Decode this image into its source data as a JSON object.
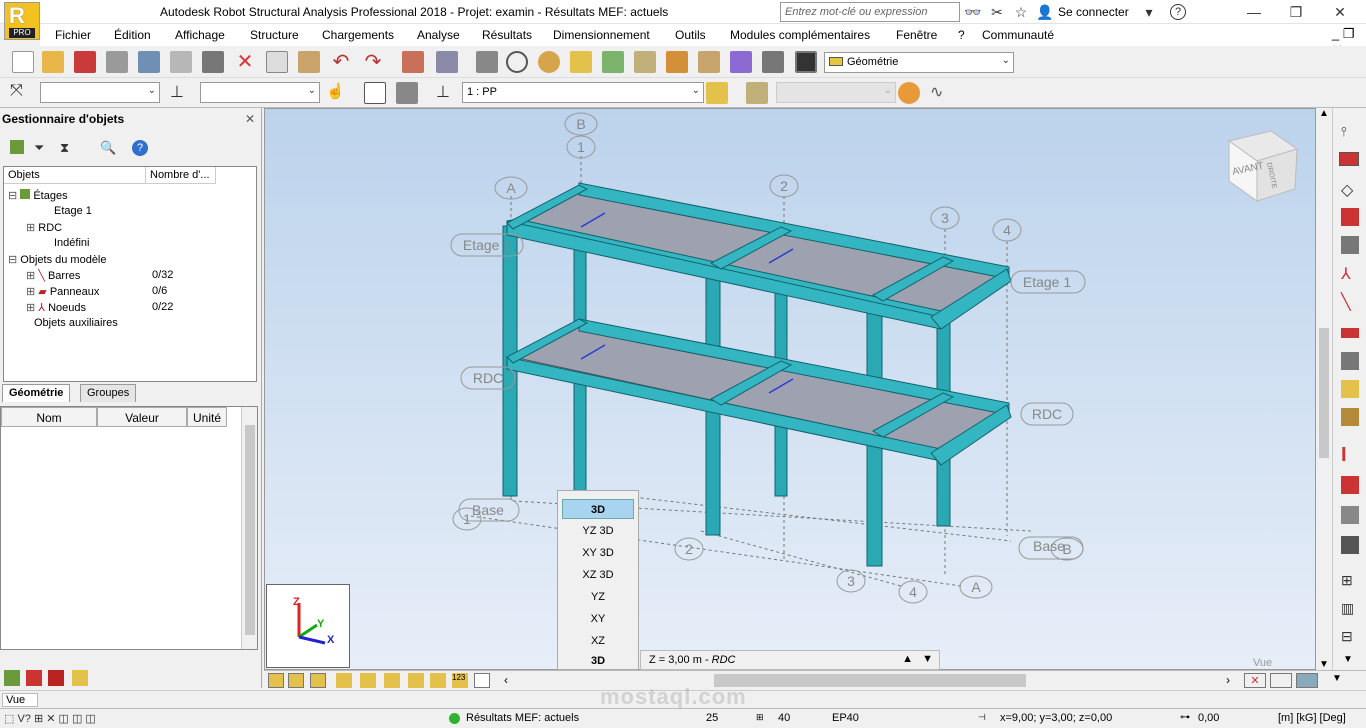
{
  "window": {
    "title": "Autodesk Robot Structural Analysis Professional 2018 - Projet: examin - Résultats MEF: actuels",
    "search_placeholder": "Entrez mot-clé ou expression",
    "signin": "Se connecter",
    "logo_badge": "PRO"
  },
  "menu": [
    "Fichier",
    "Édition",
    "Affichage",
    "Structure",
    "Chargements",
    "Analyse",
    "Résultats",
    "Dimensionnement",
    "Outils",
    "Modules complémentaires",
    "Fenêtre",
    "?",
    "Communauté"
  ],
  "toolbar": {
    "layout_combo": "Géométrie",
    "case_combo": "1 : PP"
  },
  "object_manager": {
    "title": "Gestionnaire d'objets",
    "columns": [
      "Objets",
      "Nombre d'..."
    ],
    "tree": [
      {
        "label": "Étages",
        "count": ""
      },
      {
        "label": "Etage 1",
        "count": ""
      },
      {
        "label": "RDC",
        "count": ""
      },
      {
        "label": "Indéfini",
        "count": ""
      },
      {
        "label": "Objets du modèle",
        "count": ""
      },
      {
        "label": "Barres",
        "count": "0/32"
      },
      {
        "label": "Panneaux",
        "count": "0/6"
      },
      {
        "label": "Noeuds",
        "count": "0/22"
      },
      {
        "label": "Objets auxiliaires",
        "count": ""
      }
    ],
    "tabs": [
      "Géométrie",
      "Groupes"
    ],
    "prop_columns": [
      "Nom",
      "Valeur",
      "Unité"
    ]
  },
  "viewport": {
    "grid_labels": [
      "A",
      "B",
      "1",
      "2",
      "3",
      "4",
      "A",
      "B",
      "1",
      "2",
      "3",
      "4"
    ],
    "levels": [
      "Etage 1",
      "Etage 1",
      "RDC",
      "RDC",
      "Base",
      "Base"
    ],
    "cube_label": "AVANT",
    "cube_side": "DROITE",
    "view_options": [
      "3D",
      "YZ 3D",
      "XY 3D",
      "XZ 3D",
      "YZ",
      "XY",
      "XZ"
    ],
    "current_view": "3D",
    "z_level": "Z = 3,00 m - ",
    "z_level_name": "RDC",
    "corner_label": "Vue",
    "axis_labels": [
      "Z",
      "Y",
      "X"
    ]
  },
  "vue_field": "Vue",
  "status": {
    "results": "Résultats MEF: actuels",
    "n1": "25",
    "n2": "40",
    "section": "EP40",
    "coords": "x=9,00; y=3,00; z=0,00",
    "angle": "0,00",
    "units": "[m] [kG] [Deg]"
  },
  "watermark": "mostaql.com"
}
